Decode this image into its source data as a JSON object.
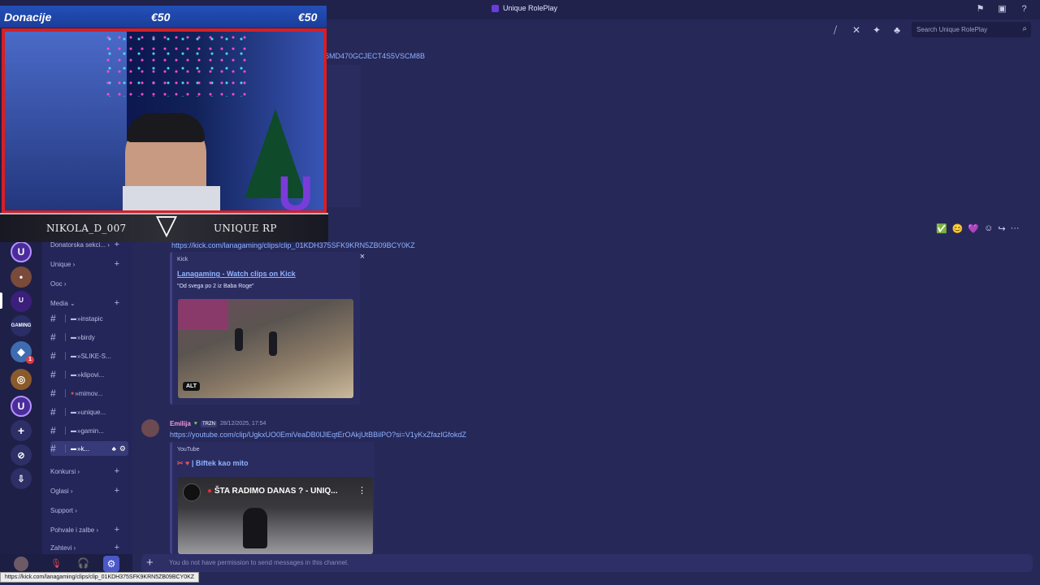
{
  "window": {
    "title": "Unique RolePlay"
  },
  "titlebar_icons": [
    "flag-icon",
    "inbox-icon",
    "help-icon"
  ],
  "header": {
    "icons": [
      "threads-icon",
      "mute-icon",
      "pin-icon",
      "members-icon"
    ],
    "search_placeholder": "Search Unique RolePlay"
  },
  "partial_top_text": "6MD470GCJECT4S5VSCM8B",
  "channels": {
    "categories": [
      {
        "label": "Donatorska sekci...",
        "arrow": "›"
      },
      {
        "label": "Unique",
        "arrow": "›"
      },
      {
        "label": "Ooc",
        "arrow": "›"
      },
      {
        "label": "Media",
        "arrow": "⌄"
      },
      {
        "label": "Konkursi",
        "arrow": "›"
      },
      {
        "label": "Oglasi",
        "arrow": "›"
      },
      {
        "label": "Support",
        "arrow": "›"
      },
      {
        "label": "Pohvale i zalbe",
        "arrow": "›"
      },
      {
        "label": "Zahtevi",
        "arrow": "›"
      }
    ],
    "items": [
      {
        "label": "»instapic",
        "emoji": "▬"
      },
      {
        "label": "»birdy",
        "emoji": "▬"
      },
      {
        "label": "»SLIKE-S...",
        "emoji": "▬"
      },
      {
        "label": "»klipovi...",
        "emoji": "▬"
      },
      {
        "label": "»mimov...",
        "emoji": "●"
      },
      {
        "label": "»unique...",
        "emoji": "▬"
      },
      {
        "label": "»gamin...",
        "emoji": "▬"
      },
      {
        "label": "»k...",
        "emoji": "▬"
      }
    ]
  },
  "messages": [
    {
      "link": "https://kick.com/lanagaming/clips/clip_01KDH375SFK9KRN5ZB09BCY0KZ",
      "embed": {
        "provider": "Kick",
        "title": "Lanagaming - Watch clips on Kick",
        "description": "\"Od svega po 2 iz Baba Roge\"",
        "alt_badge": "ALT",
        "close": "×"
      }
    },
    {
      "author": "Emilija",
      "tag": "TRZN",
      "timestamp": "28/12/2025, 17:54",
      "link": "https://youtube.com/clip/UgkxUO0EmiVeaDB0lJlEqtErOAkjUtBBilPO?si=V1yKxZfazlGfokdZ",
      "embed": {
        "provider": "YouTube",
        "title": "| Biftek kao mito",
        "video_title": "ŠTA RADIMO DANAS ? - UNIQ..."
      }
    }
  ],
  "reactions": [
    "✅",
    "😊",
    "💜",
    "☺",
    "↪",
    "···"
  ],
  "input": {
    "placeholder": "You do not have permission to send messages in this channel."
  },
  "status_url": "https://kick.com/lanagaming/clips/clip_01KDH375SFK9KRN5ZB09BCY0KZ",
  "overlay": {
    "donation_label": "Donacije",
    "amount_1": "€50",
    "amount_2": "€50",
    "streamer_name": "NIKOLA_D_007",
    "server_name": "UNIQUE RP"
  },
  "colors": {
    "accent": "#8fb2ff",
    "overlay_red": "#d61f26",
    "overlay_blue": "#2350b8"
  }
}
